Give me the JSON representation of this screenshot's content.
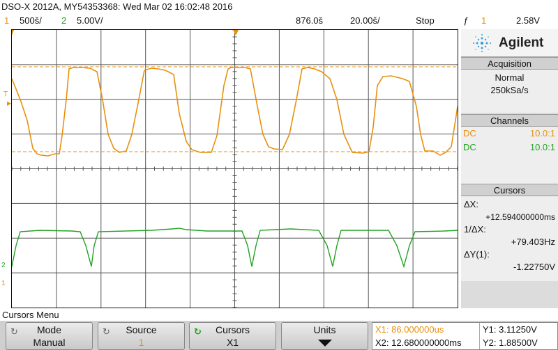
{
  "header": {
    "title": "DSO-X 2012A, MY54353368: Wed Mar 02 16:02:48 2016",
    "ch1_num": "1",
    "ch1_scale": "500š/",
    "ch2_num": "2",
    "ch2_scale": "5.00V/",
    "time_delay": "876.0š",
    "time_scale": "20.00š/",
    "run_state": "Stop",
    "trigger_icon": "ƒ",
    "trigger_source": "1",
    "trigger_level": "2.58V"
  },
  "markers": {
    "trigger_marker": "T",
    "ch2_marker": "2",
    "ch1_marker": "1"
  },
  "brand": {
    "name": "Agilent",
    "icon": "agilent-spark-icon"
  },
  "acquisition": {
    "title": "Acquisition",
    "mode": "Normal",
    "rate": "250kSa/s"
  },
  "channels": {
    "title": "Channels",
    "rows": [
      {
        "coupling": "DC",
        "probe": "10.0:1",
        "color": "#e8900e"
      },
      {
        "coupling": "DC",
        "probe": "10.0:1",
        "color": "#22a222"
      }
    ]
  },
  "cursors": {
    "title": "Cursors",
    "dx_label": "ΔX:",
    "dx_value": "+12.594000000ms",
    "inv_dx_label": "1/ΔX:",
    "inv_dx_value": "+79.403Hz",
    "dy_label": "ΔY(1):",
    "dy_value": "-1.22750V"
  },
  "softkeys": {
    "menu_title": "Cursors Menu",
    "keys": [
      {
        "label": "Mode",
        "value": "Manual"
      },
      {
        "label": "Source",
        "value": "1"
      },
      {
        "label": "Cursors",
        "value": "X1"
      },
      {
        "label": "Units",
        "value": ""
      }
    ]
  },
  "readout": {
    "x1": "X1: 86.000000us",
    "x2": "X2: 12.680000000ms",
    "y1": "Y1: 3.11250V",
    "y2": "Y2: 1.88500V"
  },
  "colors": {
    "ch1": "#e8900e",
    "ch2": "#22a222",
    "grid": "#555555"
  }
}
